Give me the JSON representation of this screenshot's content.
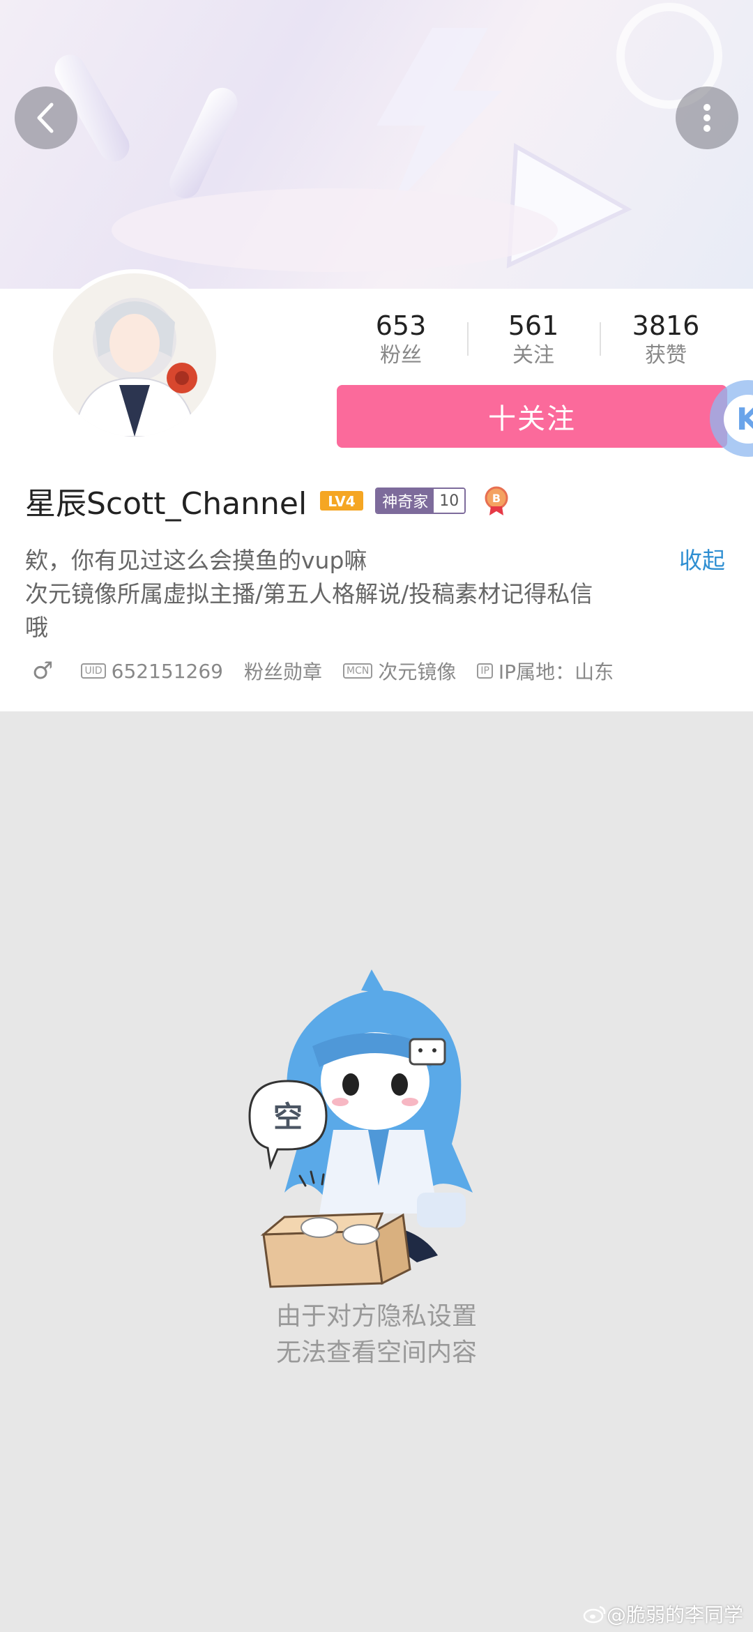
{
  "header": {
    "back_icon": "chevron-left-icon",
    "more_icon": "more-vertical-icon"
  },
  "stats": [
    {
      "value": "653",
      "label": "粉丝"
    },
    {
      "value": "561",
      "label": "关注"
    },
    {
      "value": "3816",
      "label": "获赞"
    }
  ],
  "follow_button": "十关注",
  "profile": {
    "username": "星辰Scott_Channel",
    "level": "LV4",
    "title_badge": {
      "name": "神奇家",
      "level": "10"
    },
    "bio_lines": [
      "欸，你有见过这么会摸鱼的vup嘛",
      "次元镜像所属虚拟主播/第五人格解说/投稿素材记得私信",
      "哦"
    ],
    "collapse_label": "收起",
    "gender_symbol": "♂",
    "uid_chip": "UID",
    "uid": "652151269",
    "fan_medal": "粉丝勋章",
    "mcn_chip": "MCN",
    "mcn": "次元镜像",
    "ip_chip": "IP",
    "ip_location": "IP属地：山东"
  },
  "empty_state": {
    "bubble_text": "空",
    "line1": "由于对方隐私设置",
    "line2": "无法查看空间内容"
  },
  "watermark": "@脆弱的李同学",
  "colors": {
    "follow_pink": "#fb6a9b",
    "link_blue": "#2f8fd2",
    "title_badge_purple": "#7d6b9b",
    "level_orange": "#f5a623"
  }
}
